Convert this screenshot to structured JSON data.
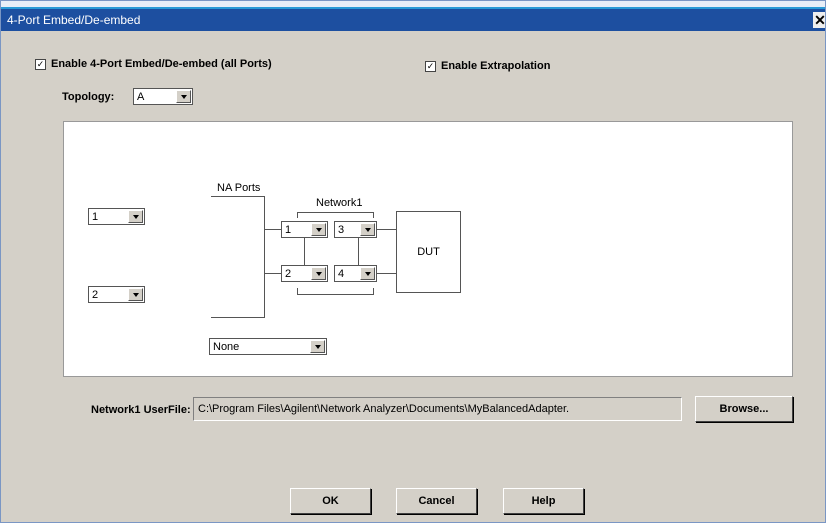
{
  "window": {
    "title": "4-Port Embed/De-embed",
    "close_glyph": "✕"
  },
  "options": {
    "enable_embed": {
      "label": "Enable 4-Port Embed/De-embed (all Ports)",
      "checked_glyph": "✓"
    },
    "enable_extrapolation": {
      "label": "Enable Extrapolation",
      "checked_glyph": "✓"
    },
    "topology": {
      "label": "Topology:",
      "value": "A"
    }
  },
  "diagram": {
    "na_ports_label": "NA Ports",
    "network_label": "Network1",
    "dut_label": "DUT",
    "left_port_top": "1",
    "left_port_bottom": "2",
    "net_port_1": "1",
    "net_port_2": "2",
    "net_port_3": "3",
    "net_port_4": "4",
    "bottom_select": "None"
  },
  "userfile": {
    "label": "Network1 UserFile:",
    "path": "C:\\Program Files\\Agilent\\Network Analyzer\\Documents\\MyBalancedAdapter.",
    "browse_label": "Browse..."
  },
  "buttons": {
    "ok": "OK",
    "cancel": "Cancel",
    "help": "Help"
  }
}
